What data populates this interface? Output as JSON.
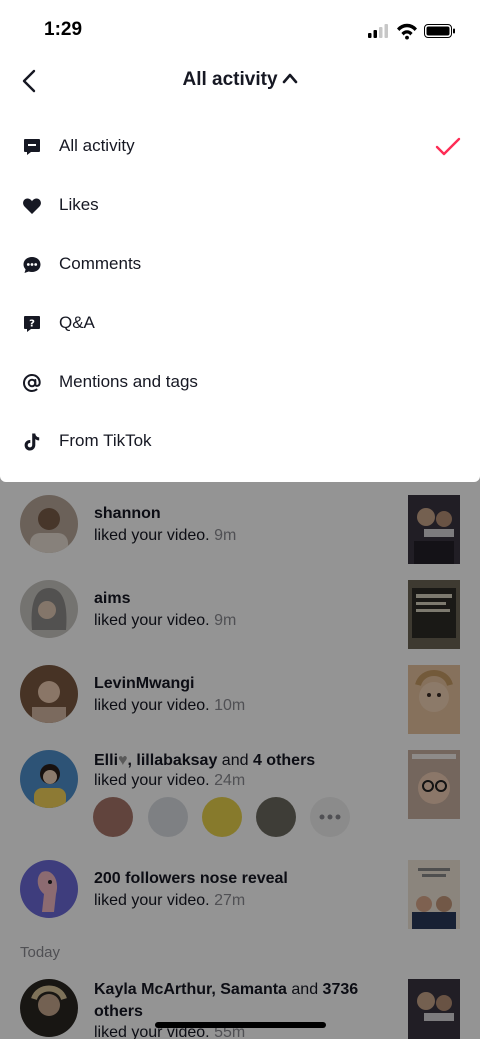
{
  "status_bar": {
    "time": "1:29"
  },
  "header": {
    "title": "All activity"
  },
  "menu": {
    "items": [
      {
        "label": "All activity",
        "icon": "chat-bubble-icon",
        "selected": true
      },
      {
        "label": "Likes",
        "icon": "heart-icon",
        "selected": false
      },
      {
        "label": "Comments",
        "icon": "comment-dots-icon",
        "selected": false
      },
      {
        "label": "Q&A",
        "icon": "question-bubble-icon",
        "selected": false
      },
      {
        "label": "Mentions and tags",
        "icon": "at-icon",
        "selected": false
      },
      {
        "label": "From TikTok",
        "icon": "tiktok-icon",
        "selected": false
      }
    ]
  },
  "feed": {
    "items": [
      {
        "name": "shannon",
        "action": "liked your video.",
        "time": "9m"
      },
      {
        "name": "aims",
        "action": "liked your video.",
        "time": "9m"
      },
      {
        "name": "LevinMwangi",
        "action": "liked your video.",
        "time": "10m"
      },
      {
        "name_part1": "Elli",
        "name_part2": ", lillabaksay",
        "name_join": " and ",
        "name_part3": "4 others",
        "action": "liked your video.",
        "time": "24m"
      },
      {
        "name": "200 followers nose reveal",
        "action": "liked your video.",
        "time": "27m"
      }
    ],
    "section_today": "Today",
    "today_item": {
      "name_part1": "Kayla McArthur, Samanta",
      "name_join": " and ",
      "name_part2": "3736",
      "name_line2": "others",
      "action": "liked your video.",
      "time": "55m"
    }
  },
  "colors": {
    "accent": "#fe2c55",
    "text": "#161823",
    "muted": "#8a8b91"
  }
}
